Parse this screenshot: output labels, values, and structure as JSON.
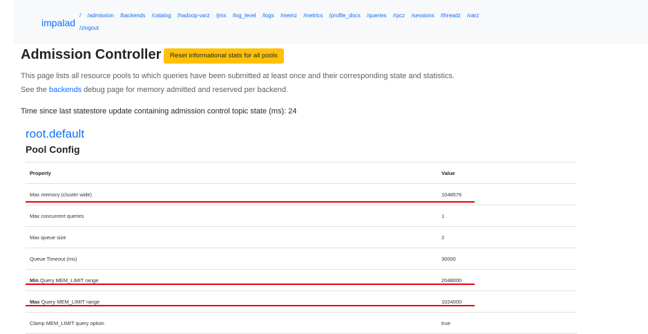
{
  "navbar": {
    "brand": "impalad",
    "links": [
      "/",
      "/admission",
      "/backends",
      "/catalog",
      "/hadoop-varz",
      "/jmx",
      "/log_level",
      "/logs",
      "/memz",
      "/metrics",
      "/profile_docs",
      "/queries",
      "/rpcz",
      "/sessions",
      "/threadz",
      "/varz",
      "/ziogout"
    ]
  },
  "page": {
    "title": "Admission Controller",
    "reset_button": "Reset informational stats for all pools",
    "desc1": "This page lists all resource pools to which queries have been submitted at least once and their corresponding state and statistics.",
    "desc2_prefix": "See the",
    "desc2_link": "backends",
    "desc2_suffix": "debug page for memory admitted and reserved per backend.",
    "statestore_label": "Time since last statestore update containing admission control topic state (ms):",
    "statestore_value": "24"
  },
  "pool": {
    "name": "root.default",
    "config_heading": "Pool Config",
    "columns": [
      "Property",
      "Value"
    ],
    "rows": [
      {
        "bold": "",
        "label": "Max memory (cluster wide)",
        "value": "1048576"
      },
      {
        "bold": "",
        "label": "Max concurrent queries",
        "value": "1"
      },
      {
        "bold": "",
        "label": "Max queue size",
        "value": "2"
      },
      {
        "bold": "",
        "label": "Queue Timeout (ms)",
        "value": "30000"
      },
      {
        "bold": "Min",
        "label": "Query MEM_LIMIT range",
        "value": "2048000"
      },
      {
        "bold": "Max",
        "label": "Query MEM_LIMIT range",
        "value": "1024000"
      },
      {
        "bold": "",
        "label": "Clamp MEM_LIMIT query option",
        "value": "true"
      }
    ]
  },
  "colors": {
    "accent": "#0d6efd",
    "button": "#ffc107",
    "highlight": "#e8000a"
  }
}
